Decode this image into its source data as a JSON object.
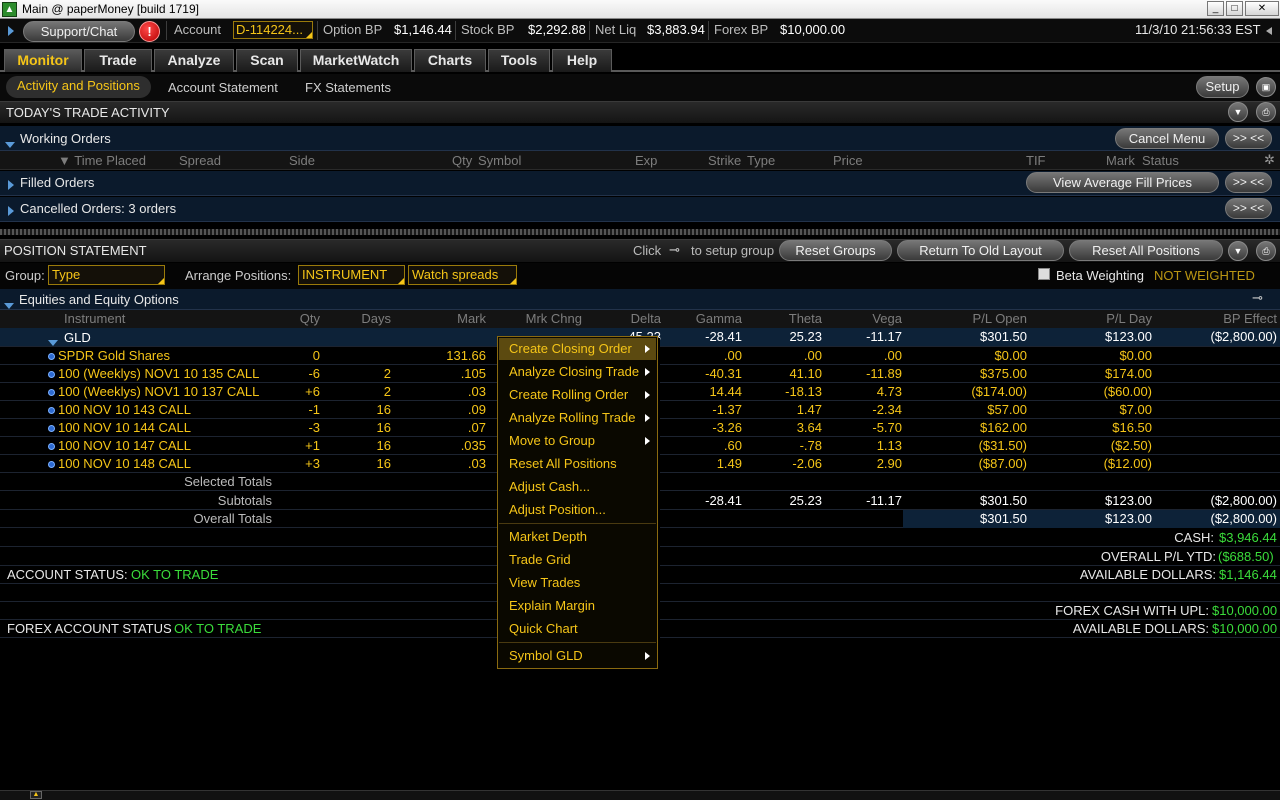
{
  "window": {
    "title": "Main @ paperMoney [build 1719]"
  },
  "header": {
    "support_label": "Support/Chat",
    "alert_label": "!",
    "account_label": "Account",
    "account_value": "D-114224...",
    "option_bp_label": "Option BP",
    "option_bp_value": "$1,146.44",
    "stock_bp_label": "Stock BP",
    "stock_bp_value": "$2,292.88",
    "net_liq_label": "Net Liq",
    "net_liq_value": "$3,883.94",
    "forex_bp_label": "Forex BP",
    "forex_bp_value": "$10,000.00",
    "datetime": "11/3/10 21:56:33 EST"
  },
  "tabs": [
    "Monitor",
    "Trade",
    "Analyze",
    "Scan",
    "MarketWatch",
    "Charts",
    "Tools",
    "Help"
  ],
  "subtabs": [
    "Activity and Positions",
    "Account Statement",
    "FX Statements"
  ],
  "setup_label": "Setup",
  "trade_activity": {
    "title": "TODAY'S TRADE ACTIVITY",
    "working_orders": "Working Orders",
    "cancel_menu": "Cancel Menu",
    "expand": ">> <<",
    "columns": [
      "Time Placed",
      "Spread",
      "Side",
      "Qty",
      "Symbol",
      "Exp",
      "Strike",
      "Type",
      "Price",
      "TIF",
      "Mark",
      "Status"
    ],
    "filled_orders": "Filled Orders",
    "view_avg": "View Average Fill Prices",
    "cancelled_orders": "Cancelled Orders: 3 orders"
  },
  "positions": {
    "title": "POSITION STATEMENT",
    "click_text": "Click",
    "setup_group_text": "to setup group",
    "reset_groups": "Reset Groups",
    "return_layout": "Return To Old Layout",
    "reset_all": "Reset All Positions",
    "group_label": "Group:",
    "group_value": "Type",
    "arrange_label": "Arrange Positions:",
    "arrange_value": "INSTRUMENT",
    "watch_value": "Watch spreads",
    "beta_label": "Beta Weighting",
    "beta_value": "NOT WEIGHTED",
    "section": "Equities and Equity Options",
    "columns": [
      "Instrument",
      "Qty",
      "Days",
      "Mark",
      "Mrk Chng",
      "Delta",
      "Gamma",
      "Theta",
      "Vega",
      "P/L Open",
      "P/L Day",
      "BP Effect"
    ],
    "group_row": {
      "instrument": "GLD",
      "delta": "45.23",
      "gamma": "-28.41",
      "theta": "25.23",
      "vega": "-11.17",
      "pl_open": "$301.50",
      "pl_day": "$123.00",
      "bp": "($2,800.00)"
    },
    "rows": [
      {
        "instrument": "SPDR Gold Shares",
        "qty": "0",
        "days": "",
        "mark": "131.66",
        "gamma": ".00",
        "theta": ".00",
        "vega": ".00",
        "pl_open": "$0.00",
        "pl_day": "$0.00"
      },
      {
        "instrument": "100 (Weeklys) NOV1 10 135 CALL",
        "qty": "-6",
        "days": "2",
        "mark": ".105",
        "gamma": "-40.31",
        "theta": "41.10",
        "vega": "-11.89",
        "pl_open": "$375.00",
        "pl_day": "$174.00"
      },
      {
        "instrument": "100 (Weeklys) NOV1 10 137 CALL",
        "qty": "+6",
        "days": "2",
        "mark": ".03",
        "gamma": "14.44",
        "theta": "-18.13",
        "vega": "4.73",
        "pl_open": "($174.00)",
        "pl_day": "($60.00)"
      },
      {
        "instrument": "100 NOV 10 143 CALL",
        "qty": "-1",
        "days": "16",
        "mark": ".09",
        "gamma": "-1.37",
        "theta": "1.47",
        "vega": "-2.34",
        "pl_open": "$57.00",
        "pl_day": "$7.00"
      },
      {
        "instrument": "100 NOV 10 144 CALL",
        "qty": "-3",
        "days": "16",
        "mark": ".07",
        "gamma": "-3.26",
        "theta": "3.64",
        "vega": "-5.70",
        "pl_open": "$162.00",
        "pl_day": "$16.50"
      },
      {
        "instrument": "100 NOV 10 147 CALL",
        "qty": "+1",
        "days": "16",
        "mark": ".035",
        "gamma": ".60",
        "theta": "-.78",
        "vega": "1.13",
        "pl_open": "($31.50)",
        "pl_day": "($2.50)"
      },
      {
        "instrument": "100 NOV 10 148 CALL",
        "qty": "+3",
        "days": "16",
        "mark": ".03",
        "gamma": "1.49",
        "theta": "-2.06",
        "vega": "2.90",
        "pl_open": "($87.00)",
        "pl_day": "($12.00)"
      }
    ],
    "selected_totals": "Selected Totals",
    "subtotals": {
      "label": "Subtotals",
      "gamma": "-28.41",
      "theta": "25.23",
      "vega": "-11.17",
      "pl_open": "$301.50",
      "pl_day": "$123.00",
      "bp": "($2,800.00)"
    },
    "overall": {
      "label": "Overall Totals",
      "pl_open": "$301.50",
      "pl_day": "$123.00",
      "bp": "($2,800.00)"
    }
  },
  "summary": {
    "cash_label": "CASH:",
    "cash_value": "$3,946.44",
    "overall_pl_label": "OVERALL P/L YTD:",
    "overall_pl_value": "($688.50)",
    "account_status_label": "ACCOUNT STATUS:",
    "account_status_value": "OK TO TRADE",
    "avail_label": "AVAILABLE DOLLARS:",
    "avail_value": "$1,146.44",
    "forex_cash_label": "FOREX CASH WITH UPL:",
    "forex_cash_value": "$10,000.00",
    "forex_status_label": "FOREX ACCOUNT STATUS",
    "forex_status_value": "OK TO TRADE",
    "forex_avail_label": "AVAILABLE DOLLARS:",
    "forex_avail_value": "$10,000.00"
  },
  "context_menu": {
    "items": [
      "Create Closing Order",
      "Analyze Closing Trade",
      "Create Rolling Order",
      "Analyze Rolling Trade",
      "Move to Group",
      "Reset All Positions",
      "Adjust Cash...",
      "Adjust Position...",
      "Market Depth",
      "Trade Grid",
      "View Trades",
      "Explain Margin",
      "Quick Chart",
      "Symbol GLD"
    ]
  },
  "colors": {
    "accent": "#f5c518",
    "positive": "#3bdc3b",
    "row_bg": "#0b1a2c"
  }
}
